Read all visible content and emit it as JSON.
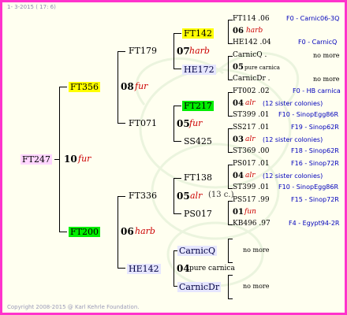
{
  "header": "1-  3-2015 ( 17:  6)",
  "footer": "Copyright 2008-2015 @ Karl Kehrle Foundation.",
  "root": {
    "code": "FT247",
    "num": "10",
    "race": "fur"
  },
  "gen1": {
    "top": {
      "code": "FT356",
      "num": "08",
      "race": "fur"
    },
    "bottom": {
      "code": "FT200",
      "num": "06",
      "race": "harb"
    }
  },
  "gen2": {
    "a": {
      "code": "FT179",
      "num": "07",
      "race": "harb"
    },
    "b": {
      "code": "FT071",
      "num": "05",
      "race": "fur"
    },
    "c": {
      "code": "FT336",
      "num": "05",
      "race": "alr",
      "note": "(13 c.)"
    },
    "d": {
      "code": "HE142",
      "num": "04",
      "race": "pure carnica"
    }
  },
  "gen3": {
    "a1": "FT142",
    "a2": "HE172",
    "b1": "FT217",
    "b2": "SS425",
    "c1": "FT138",
    "c2": "PS017",
    "d1": "CarnicQ",
    "d2": "CarnicDr"
  },
  "gen4": {
    "g1": {
      "top": "FT114 .06",
      "num": "06",
      "race": "harb",
      "bottom": "HE142 .04",
      "ped_top": "F0 - Carnic06-3Q",
      "ped_bottom": "F0 - CarnicQ"
    },
    "g2": {
      "top": "CarnicQ .",
      "num": "05",
      "race": "pure carnica",
      "bottom": "CarnicDr .",
      "ped_top": "no more",
      "ped_bottom": "no more"
    },
    "g3": {
      "top": "FT002 .02",
      "num": "04",
      "race": "alr",
      "note": "(12 sister colonies)",
      "bottom": "ST399 .01",
      "ped_top": "F0 - HB carnica",
      "ped_bottom": "F10 - SinopEgg86R"
    },
    "g4": {
      "top": "SS217 .01",
      "num": "03",
      "race": "alr",
      "note": "(12 sister colonies)",
      "bottom": "ST369 .00",
      "ped_top": "F19 - Sinop62R",
      "ped_bottom": "F18 - Sinop62R"
    },
    "g5": {
      "top": "PS017 .01",
      "num": "04",
      "race": "alr",
      "note": "(12 sister colonies)",
      "bottom": "ST399 .01",
      "ped_top": "F16 - Sinop72R",
      "ped_bottom": "F10 - SinopEgg86R"
    },
    "g6": {
      "top": "PS517 .99",
      "num": "01",
      "race": "fun",
      "bottom": "KB496 .97",
      "ped_top": "F15 - Sinop72R",
      "ped_bottom": "F4 - Egypt94-2R"
    },
    "g7": {
      "no_more": "no more"
    },
    "g8": {
      "no_more": "no more"
    }
  },
  "colors": {
    "frame": "#ff33cc",
    "highlight_yellow": "#ffff00",
    "highlight_green": "#00ee00",
    "race_red": "#cc0000",
    "pedigree_blue": "#0000bb"
  }
}
